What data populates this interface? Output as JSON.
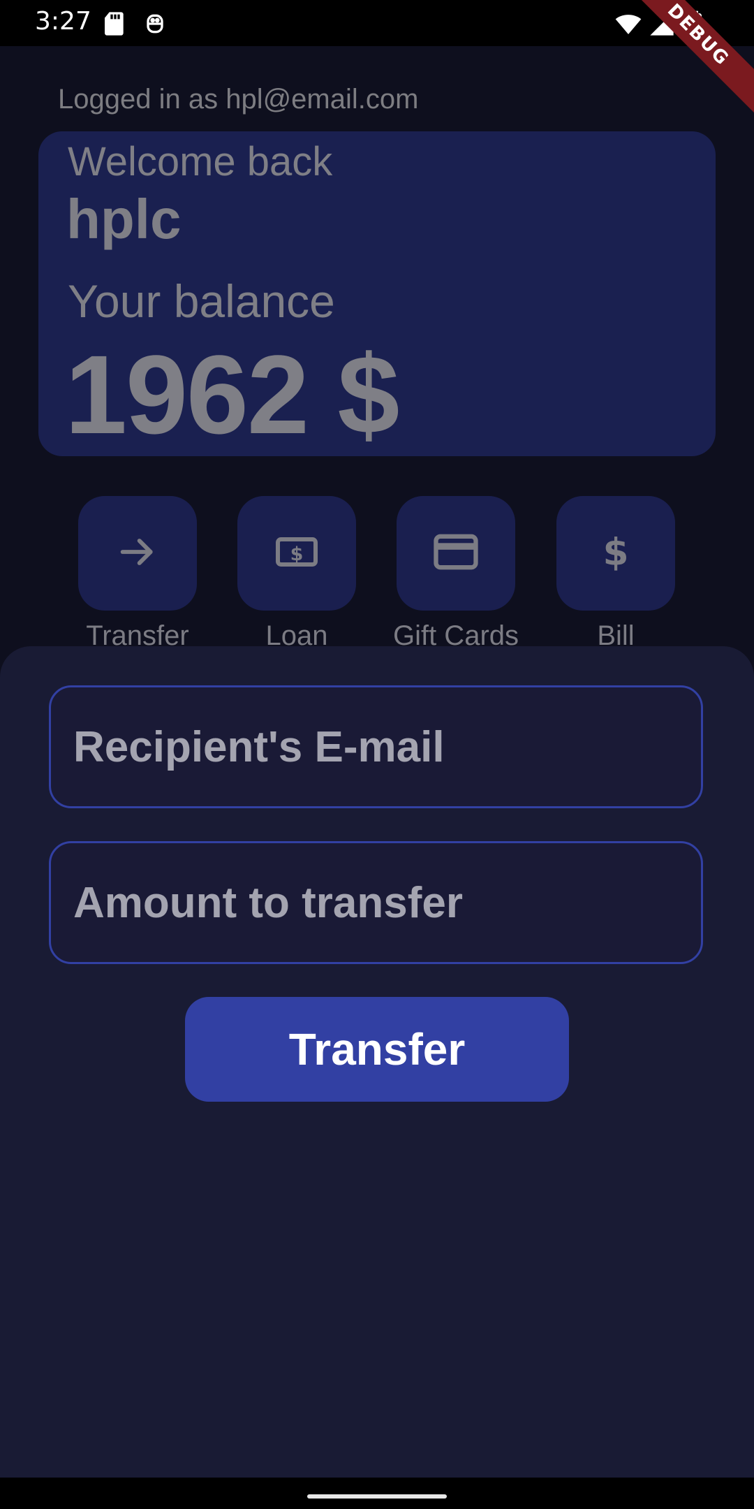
{
  "status_bar": {
    "time": "3:27",
    "debug_label": "DEBUG",
    "icons": [
      "sd-card-icon",
      "notification-icon",
      "wifi-icon",
      "signal-icon",
      "battery-icon"
    ]
  },
  "header": {
    "logged_in_text": "Logged in as hpl@email.com"
  },
  "welcome_card": {
    "welcome": "Welcome back",
    "username": "hplc",
    "balance_label": "Your balance",
    "balance": "1962 $"
  },
  "actions": [
    {
      "label": "Transfer",
      "icon": "arrow-right-icon"
    },
    {
      "label": "Loan",
      "icon": "money-bill-icon"
    },
    {
      "label": "Gift Cards",
      "icon": "credit-card-icon"
    },
    {
      "label": "Bill",
      "icon": "dollar-icon"
    }
  ],
  "transfer_form": {
    "email_placeholder": "Recipient's E-mail",
    "amount_placeholder": "Amount to transfer",
    "submit_label": "Transfer"
  },
  "colors": {
    "background": "#0e0f1e",
    "card": "#1a2050",
    "sheet": "#191b34",
    "accent": "#3240a3",
    "debug_ribbon": "#7b1a1f"
  }
}
